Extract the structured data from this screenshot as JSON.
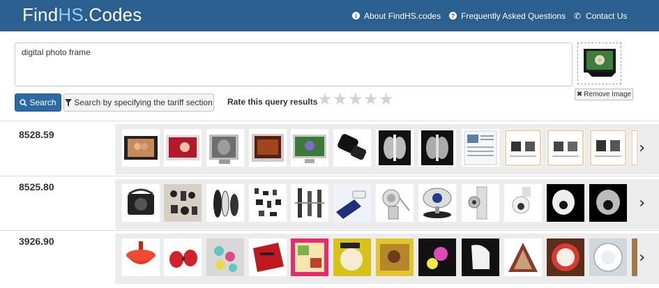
{
  "header": {
    "logo": {
      "part1": "Find",
      "part2": "HS",
      "part3": ".Codes"
    },
    "nav": [
      {
        "label": "About FindHS.codes",
        "icon": "info-icon"
      },
      {
        "label": "Frequently Asked Questions",
        "icon": "question-icon"
      },
      {
        "label": "Contact Us",
        "icon": "phone-icon"
      }
    ]
  },
  "query": {
    "value": "digital photo frame"
  },
  "buttons": {
    "search": "Search",
    "tariff": "Search by specifying the tariff section",
    "remove_image": "Remove Image"
  },
  "rating": {
    "label": "Rate this query results",
    "stars": 5,
    "selected": 0
  },
  "results": [
    {
      "code": "8528.59"
    },
    {
      "code": "8525.80"
    },
    {
      "code": "3926.90"
    }
  ],
  "colors": {
    "header": "#2b5f8e",
    "accent": "#2c6aa6"
  }
}
